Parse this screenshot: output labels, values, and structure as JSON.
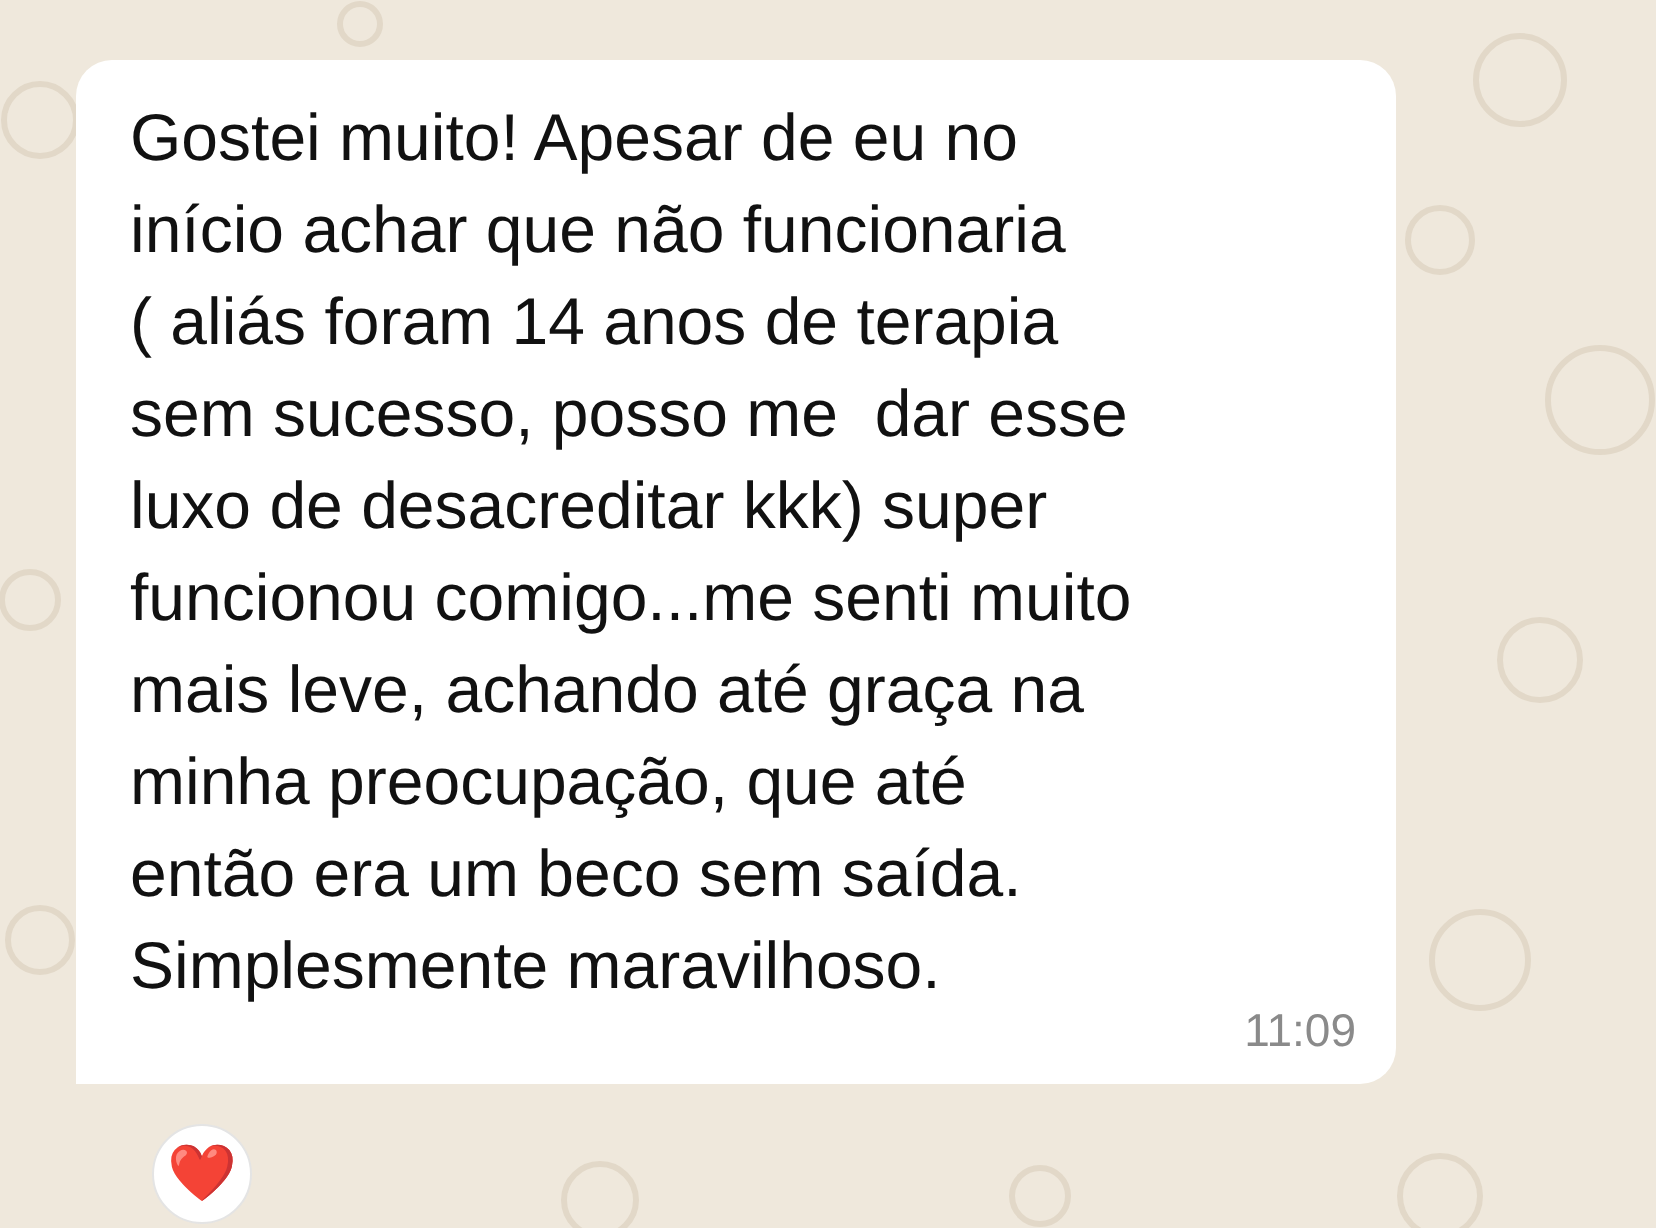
{
  "message": {
    "text": "Gostei muito! Apesar de eu no\ninício achar que não funcionaria\n( aliás foram 14 anos de terapia\nsem sucesso, posso me  dar esse\nluxo de desacreditar kkk) super\nfuncionou comigo...me senti muito\nmais leve, achando até graça na\nminha preocupação, que até\nentão era um beco sem saída.\nSimplesmente maravilhoso.",
    "time": "11:09",
    "reaction": "❤️"
  }
}
